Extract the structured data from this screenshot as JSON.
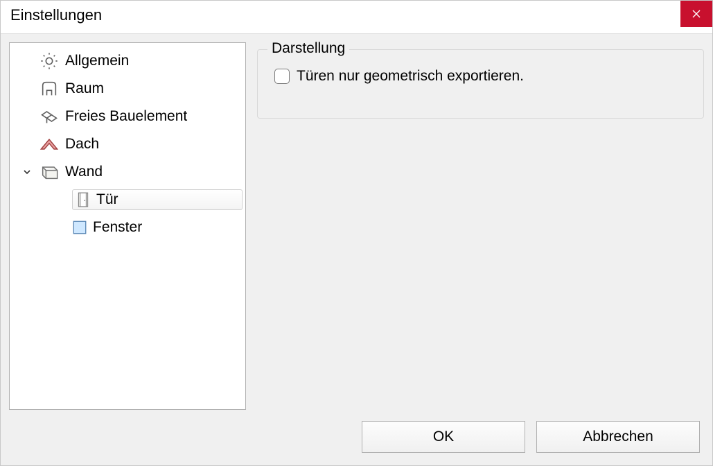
{
  "dialog": {
    "title": "Einstellungen"
  },
  "tree": {
    "items": [
      {
        "label": "Allgemein",
        "icon": "gear-icon"
      },
      {
        "label": "Raum",
        "icon": "room-icon"
      },
      {
        "label": "Freies Bauelement",
        "icon": "element-icon"
      },
      {
        "label": "Dach",
        "icon": "roof-icon"
      },
      {
        "label": "Wand",
        "icon": "wall-icon",
        "expanded": true,
        "children": [
          {
            "label": "Tür",
            "icon": "door-icon",
            "selected": true
          },
          {
            "label": "Fenster",
            "icon": "window-icon"
          }
        ]
      }
    ]
  },
  "content": {
    "group_label": "Darstellung",
    "checkbox_label": "Türen nur geometrisch exportieren.",
    "checkbox_checked": false
  },
  "footer": {
    "ok": "OK",
    "cancel": "Abbrechen"
  }
}
